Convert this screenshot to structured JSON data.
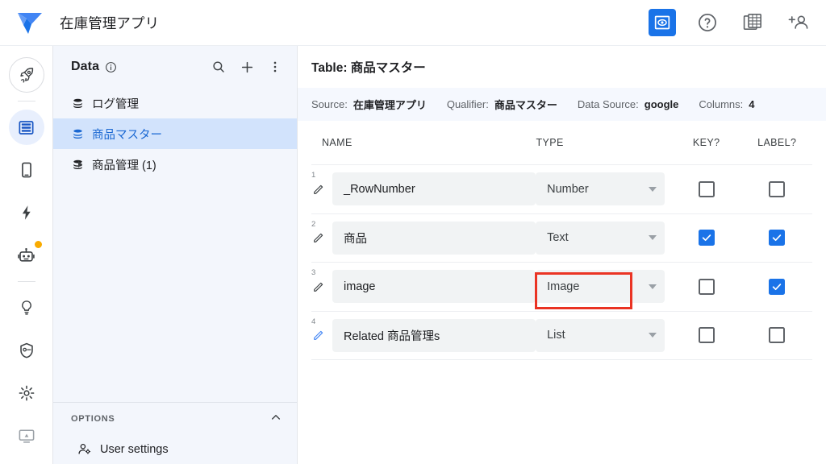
{
  "header": {
    "app_title": "在庫管理アプリ",
    "logo_icon": "appsheet-logo-icon",
    "actions": [
      {
        "name": "preview-icon",
        "label": "Preview",
        "active": true
      },
      {
        "name": "help-icon",
        "label": "Help",
        "active": false
      },
      {
        "name": "spreadsheet-icon",
        "label": "Spreadsheet",
        "active": false
      },
      {
        "name": "add-user-icon",
        "label": "Add user",
        "active": false
      }
    ]
  },
  "rail": {
    "items": [
      {
        "name": "rocket-icon",
        "label": "Deploy",
        "ring": true,
        "selected": false,
        "badge": false
      },
      {
        "name": "database-icon",
        "label": "Data",
        "ring": false,
        "selected": true,
        "badge": false
      },
      {
        "name": "phone-icon",
        "label": "App",
        "ring": false,
        "selected": false,
        "badge": false
      },
      {
        "name": "bolt-icon",
        "label": "Actions",
        "ring": false,
        "selected": false,
        "badge": false
      },
      {
        "name": "robot-icon",
        "label": "Automation",
        "ring": false,
        "selected": false,
        "badge": true
      },
      {
        "name": "bulb-icon",
        "label": "Intelligence",
        "ring": false,
        "selected": false,
        "badge": false
      },
      {
        "name": "shield-icon",
        "label": "Security",
        "ring": false,
        "selected": false,
        "badge": false
      },
      {
        "name": "gear-icon",
        "label": "Settings",
        "ring": false,
        "selected": false,
        "badge": false
      },
      {
        "name": "monitor-icon",
        "label": "Monitor",
        "ring": false,
        "selected": false,
        "badge": false
      }
    ]
  },
  "data_panel": {
    "title": "Data",
    "info_icon": "info-icon",
    "search_icon": "search-icon",
    "add_icon": "plus-icon",
    "more_icon": "more-vert-icon",
    "items": [
      {
        "label": "ログ管理",
        "selected": false,
        "expandable": false
      },
      {
        "label": "商品マスター",
        "selected": true,
        "expandable": false
      },
      {
        "label": "商品管理 (1)",
        "selected": false,
        "expandable": true
      }
    ],
    "options": {
      "label": "OPTIONS",
      "chevron_icon": "chevron-up-icon",
      "items": [
        {
          "label": "User settings",
          "icon": "user-settings-icon"
        }
      ]
    }
  },
  "main": {
    "table_title": "Table: 商品マスター",
    "meta": [
      {
        "key": "Source:",
        "value": "在庫管理アプリ"
      },
      {
        "key": "Qualifier:",
        "value": "商品マスター"
      },
      {
        "key": "Data Source:",
        "value": "google"
      },
      {
        "key": "Columns:",
        "value": "4"
      }
    ],
    "columns": [
      "NAME",
      "TYPE",
      "KEY?",
      "LABEL?"
    ],
    "rows": [
      {
        "num": "1",
        "name": "_RowNumber",
        "type": "Number",
        "key": false,
        "label": false,
        "pencil_active": false,
        "type_highlighted": false
      },
      {
        "num": "2",
        "name": "商品",
        "type": "Text",
        "key": true,
        "label": true,
        "pencil_active": false,
        "type_highlighted": false
      },
      {
        "num": "3",
        "name": "image",
        "type": "Image",
        "key": false,
        "label": true,
        "pencil_active": false,
        "type_highlighted": true
      },
      {
        "num": "4",
        "name": "Related 商品管理s",
        "type": "List",
        "key": false,
        "label": false,
        "pencil_active": true,
        "type_highlighted": false
      }
    ]
  },
  "colors": {
    "accent": "#1a73e8",
    "selected_bg": "#d2e3fc",
    "selected_text": "#1967d2",
    "panel_bg": "#f3f6fc",
    "field_bg": "#f1f3f4",
    "annotation": "#ea3323",
    "badge": "#f9ab00"
  }
}
